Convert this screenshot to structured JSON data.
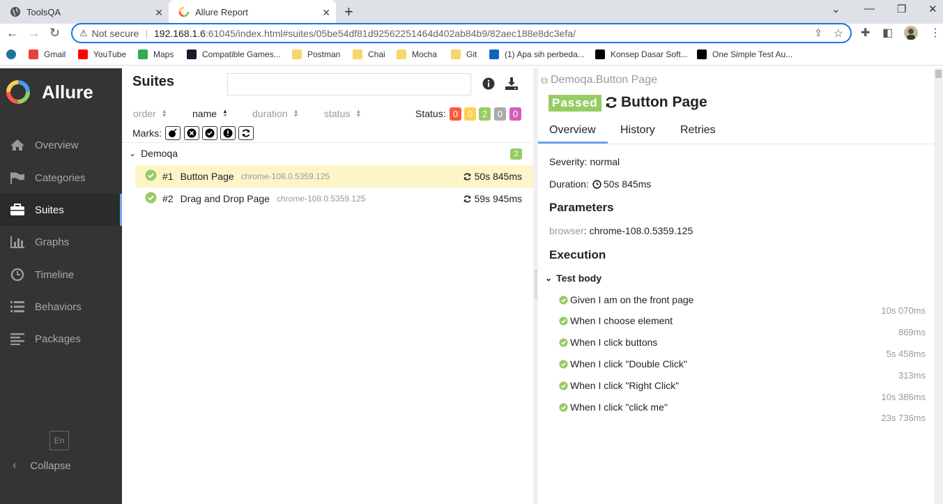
{
  "browser": {
    "tabs": [
      {
        "title": "ToolsQA"
      },
      {
        "title": "Allure Report"
      }
    ],
    "address": {
      "security": "Not secure",
      "host": "192.168.1.6",
      "path": ":61045/index.html#suites/05be54df81d92562251464d402ab84b9/82aec188e8dc3efa/"
    },
    "bookmarks": [
      {
        "label": "Gmail",
        "color": "#ea4335"
      },
      {
        "label": "YouTube",
        "color": "#ff0000"
      },
      {
        "label": "Maps",
        "color": "#34a853"
      },
      {
        "label": "Compatible Games...",
        "color": "#1a1a2e"
      },
      {
        "label": "Postman",
        "color": "#f8d76a"
      },
      {
        "label": "Chai",
        "color": "#f8d76a"
      },
      {
        "label": "Mocha",
        "color": "#f8d76a"
      },
      {
        "label": "Git",
        "color": "#f8d76a"
      },
      {
        "label": "(1) Apa sih perbeda...",
        "color": "#0a66c2"
      },
      {
        "label": "Konsep Dasar Soft...",
        "color": "#000000"
      },
      {
        "label": "One Simple Test Au...",
        "color": "#000000"
      }
    ]
  },
  "sidebar": {
    "brand": "Allure",
    "items": [
      {
        "label": "Overview",
        "icon": "home-icon"
      },
      {
        "label": "Categories",
        "icon": "flag-icon"
      },
      {
        "label": "Suites",
        "icon": "briefcase-icon",
        "active": true
      },
      {
        "label": "Graphs",
        "icon": "bar-chart-icon"
      },
      {
        "label": "Timeline",
        "icon": "clock-icon"
      },
      {
        "label": "Behaviors",
        "icon": "list-icon"
      },
      {
        "label": "Packages",
        "icon": "align-left-icon"
      }
    ],
    "language": "En",
    "collapse": "Collapse"
  },
  "suites": {
    "title": "Suites",
    "sort": {
      "order": "order",
      "name": "name",
      "duration": "duration",
      "status": "status"
    },
    "status_label": "Status:",
    "status_counts": [
      {
        "value": "0",
        "color": "#fd5a3e"
      },
      {
        "value": "0",
        "color": "#ffd050"
      },
      {
        "value": "2",
        "color": "#97cc64"
      },
      {
        "value": "0",
        "color": "#aaaaaa"
      },
      {
        "value": "0",
        "color": "#d35ebe"
      }
    ],
    "marks_label": "Marks:",
    "group": {
      "name": "Demoqa",
      "count": "2"
    },
    "tests": [
      {
        "num": "#1",
        "name": "Button Page",
        "browser": "chrome-108.0.5359.125",
        "duration": "50s 845ms"
      },
      {
        "num": "#2",
        "name": "Drag and Drop Page",
        "browser": "chrome-108.0.5359.125",
        "duration": "59s 945ms"
      }
    ]
  },
  "detail": {
    "breadcrumb": "Demoqa.Button Page",
    "status": "Passed",
    "title": "Button Page",
    "tabs": [
      "Overview",
      "History",
      "Retries"
    ],
    "severity": "Severity: normal",
    "duration_label": "Duration:",
    "duration": "50s 845ms",
    "parameters_title": "Parameters",
    "param_key": "browser",
    "param_value": "chrome-108.0.5359.125",
    "execution_title": "Execution",
    "test_body": "Test body",
    "steps": [
      {
        "name": "Given I am on the front page",
        "duration": "10s 070ms"
      },
      {
        "name": "When I choose element",
        "duration": "869ms"
      },
      {
        "name": "When I click buttons",
        "duration": "5s 458ms"
      },
      {
        "name": "When I click \"Double Click\"",
        "duration": "313ms"
      },
      {
        "name": "When I click \"Right Click\"",
        "duration": "10s 386ms"
      },
      {
        "name": "When I click \"click me\"",
        "duration": "23s 736ms"
      }
    ]
  }
}
